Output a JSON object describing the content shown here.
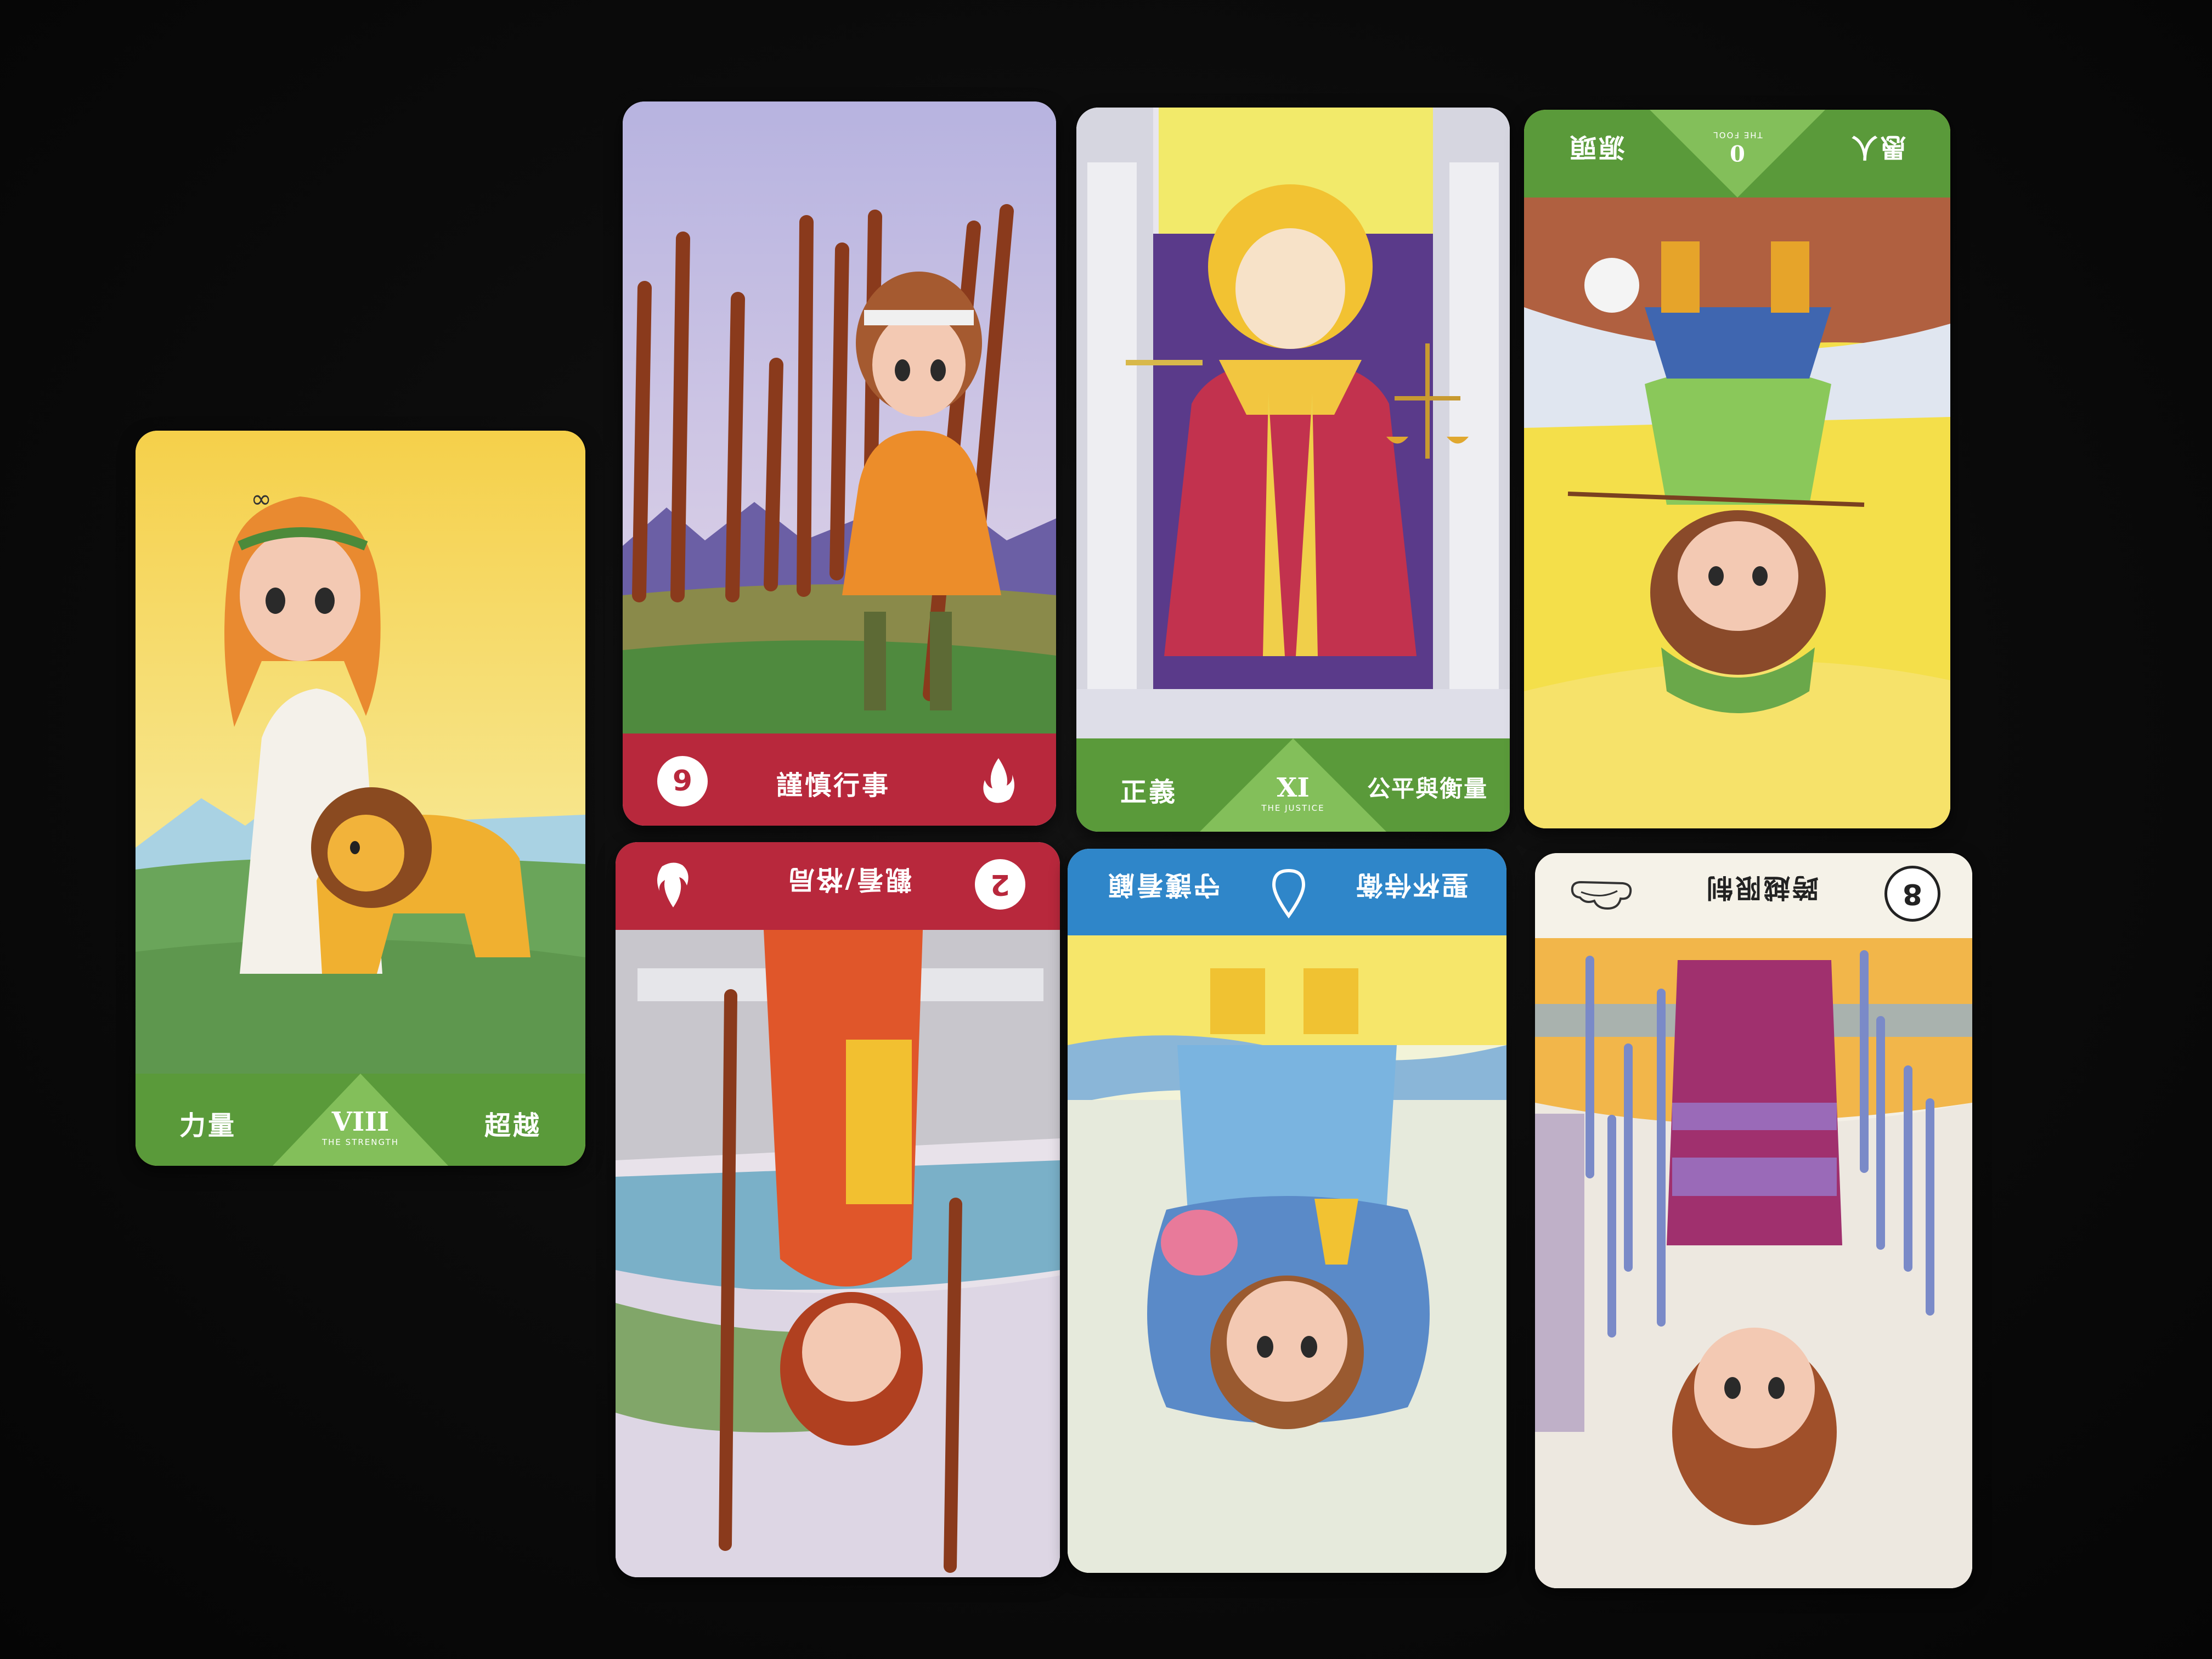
{
  "colors": {
    "background": "#0b0b0b",
    "major_green": "#5a9a3a",
    "wands_red": "#b8283c",
    "cups_blue": "#2f86c9",
    "swords_cream": "#f5f2e8"
  },
  "cards": [
    {
      "id": "strength",
      "orientation": "upright",
      "left_label": "力量",
      "right_label": "超越",
      "numeral": "VIII",
      "subtitle": "THE STRENGTH",
      "icon": "infinity-icon"
    },
    {
      "id": "nine-of-wands",
      "orientation": "upright",
      "number": "9",
      "label": "謹慎行事",
      "icon": "fire-icon"
    },
    {
      "id": "justice",
      "orientation": "upright",
      "left_label": "正義",
      "right_label": "公平與衡量",
      "numeral": "XI",
      "subtitle": "THE JUSTICE"
    },
    {
      "id": "the-fool",
      "orientation": "reversed",
      "left_label": "愚人",
      "right_label": "源頭",
      "numeral": "0",
      "subtitle": "THE FOOL"
    },
    {
      "id": "two-of-wands",
      "orientation": "reversed",
      "number": "2",
      "label": "觀看/格局",
      "icon": "fire-icon"
    },
    {
      "id": "page-of-cups",
      "orientation": "reversed",
      "left_label": "聖杯侍衛",
      "right_label": "守護看顧",
      "icon": "water-drop-icon"
    },
    {
      "id": "eight-of-swords",
      "orientation": "reversed",
      "number": "8",
      "label": "跨越限制",
      "icon": "cloud-icon"
    }
  ]
}
